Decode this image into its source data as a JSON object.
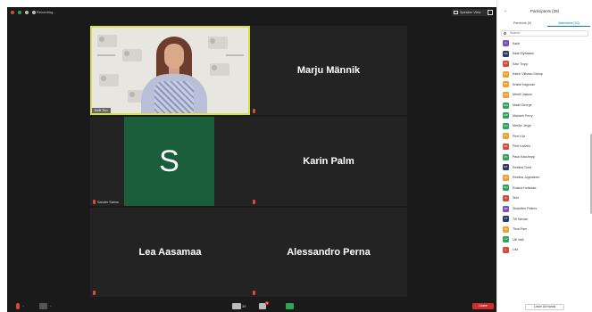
{
  "topbar": {
    "recording_label": "Recording...",
    "view_label": "Speaker View"
  },
  "tiles": {
    "video_name": "Keili Tiro",
    "avatar_letter": "S",
    "avatar_caption": "Sander Salme",
    "names": [
      "Marju Männik",
      "Karin Palm",
      "Lea Aasamaa",
      "Alessandro Perna"
    ]
  },
  "bottombar": {
    "participants_count": "39",
    "chat_badge": "9",
    "end_label": "Leave"
  },
  "panel": {
    "title": "Participants (39)",
    "tab_panelists": "Panelists (6)",
    "tab_attendees": "Attendees (33)",
    "search_placeholder": "Search",
    "lower_hands": "Lower All Hands",
    "attendees": [
      {
        "initials": "K",
        "name": "Kaidi",
        "color": "#7a4fc9"
      },
      {
        "initials": "KB",
        "name": "Kadri Byttaisen",
        "color": "#2b3a67"
      },
      {
        "initials": "KT",
        "name": "Kaie Tropp",
        "color": "#d94a3c"
      },
      {
        "initials": "KV",
        "name": "Katrin Villman-Stump",
        "color": "#f0a030"
      },
      {
        "initials": "KK",
        "name": "Kristel Kagovan",
        "color": "#f0a030"
      },
      {
        "initials": "MJ",
        "name": "Merell Jakson",
        "color": "#f0a030"
      },
      {
        "initials": "MG",
        "name": "Madli George",
        "color": "#2fa35a"
      },
      {
        "initials": "MP",
        "name": "Mariann Porry",
        "color": "#2fa35a"
      },
      {
        "initials": "MJ",
        "name": "Merike Jerge",
        "color": "#2fa35a"
      },
      {
        "initials": "PK",
        "name": "Piret Kivi",
        "color": "#f0a030"
      },
      {
        "initials": "PK",
        "name": "Piret Kalvelo",
        "color": "#d94a3c"
      },
      {
        "initials": "PK",
        "name": "Pauli Kaschepp",
        "color": "#2fa35a"
      },
      {
        "initials": "RT",
        "name": "Reelika Turet",
        "color": "#2b3a67"
      },
      {
        "initials": "RJ",
        "name": "Reelika Jogelainen",
        "color": "#f0a030"
      },
      {
        "initials": "RH",
        "name": "Rosina Holsutad",
        "color": "#2fa35a"
      },
      {
        "initials": "S",
        "name": "Sirle",
        "color": "#d94a3c"
      },
      {
        "initials": "SP",
        "name": "Sinardlen Pellers",
        "color": "#7a4fc9"
      },
      {
        "initials": "TT",
        "name": "Tiit Tahvan",
        "color": "#2b3a67"
      },
      {
        "initials": "TP",
        "name": "Tiina Parn",
        "color": "#f0a030"
      },
      {
        "initials": "UV",
        "name": "Ulli Valk",
        "color": "#2fa35a"
      },
      {
        "initials": "L",
        "name": "Liivi",
        "color": "#d94a3c"
      }
    ]
  }
}
